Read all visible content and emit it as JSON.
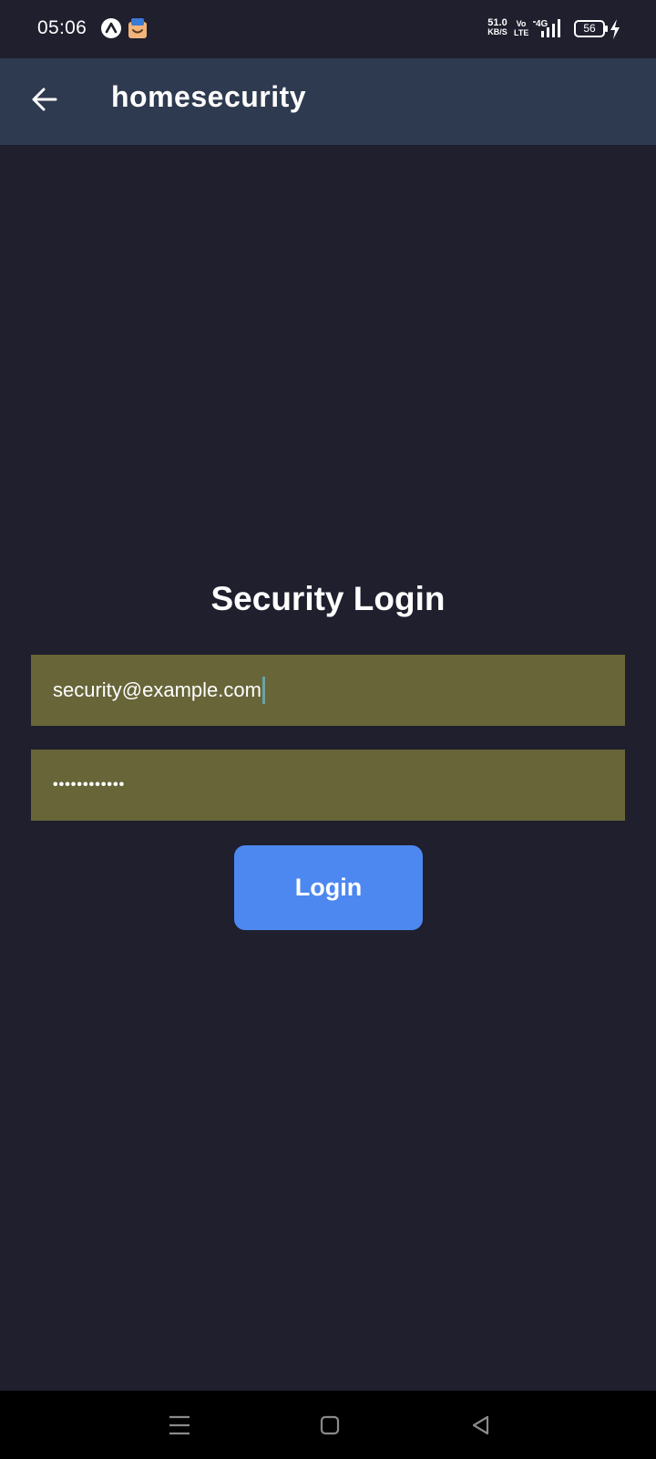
{
  "status_bar": {
    "time": "05:06",
    "net_speed_value": "51.0",
    "net_speed_unit": "KB/S",
    "volte_top": "Vo",
    "volte_bottom": "LTE",
    "network_type": "4G",
    "battery_level": "56"
  },
  "app_bar": {
    "back_icon": "arrow-left-icon",
    "title": "homesecurity"
  },
  "login": {
    "heading": "Security Login",
    "email_value": "security@example.com",
    "password_masked": "••••••••••••",
    "submit_label": "Login"
  },
  "nav_bar": {
    "icons": [
      "menu-icon",
      "home-icon",
      "back-triangle-icon"
    ]
  },
  "colors": {
    "background": "#1f1f2e",
    "app_bar": "#2e3a4f",
    "input_fill": "#686539",
    "button": "#4d88f0"
  }
}
